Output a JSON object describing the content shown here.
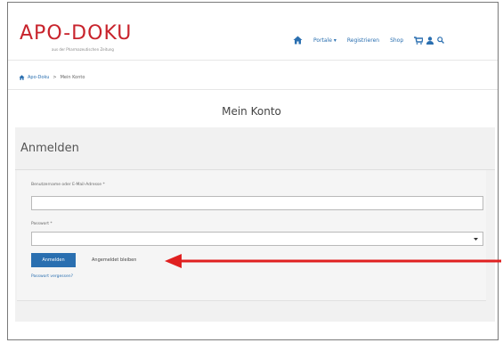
{
  "header": {
    "logo_main": "APO-DOKU",
    "logo_sub": "aus der Pharmazeutischen Zeitung",
    "nav": [
      {
        "label": "Portale ▾",
        "icon": "home-icon"
      },
      {
        "label": "Registrieren"
      },
      {
        "label": "Shop"
      }
    ],
    "icons": [
      "cart-icon",
      "user-icon",
      "search-icon"
    ]
  },
  "breadcrumb": {
    "home_label": "Apo-Doku",
    "separator": ">",
    "current": "Mein Konto"
  },
  "page_title": "Mein Konto",
  "login_panel": {
    "heading": "Anmelden",
    "username_label": "Benutzername oder E-Mail-Adresse *",
    "username_value": "",
    "password_label": "Passwort *",
    "password_value": "",
    "login_button": "Anmelden",
    "remember_label": "Angemeldet bleiben",
    "forgot_link": "Passwort vergessen?"
  },
  "colors": {
    "brand_red": "#c8232c",
    "link_blue": "#2a6fb0",
    "annotation_red": "#e02020"
  }
}
